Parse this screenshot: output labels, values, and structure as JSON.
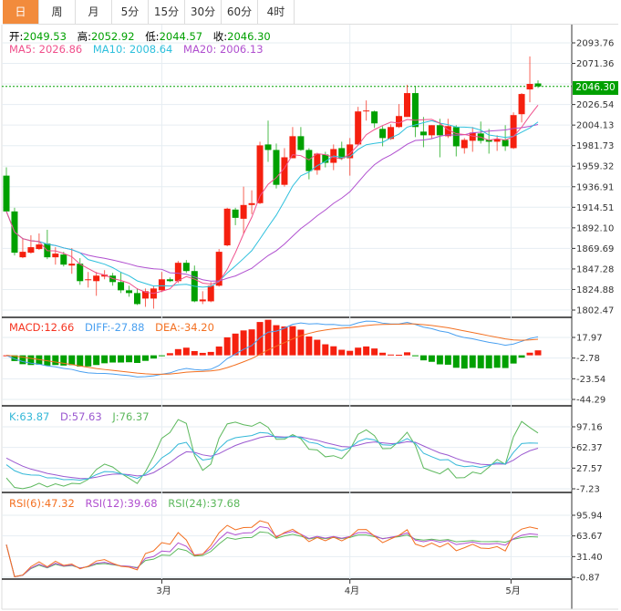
{
  "tabs": [
    "日",
    "周",
    "月",
    "5分",
    "15分",
    "30分",
    "60分",
    "4时"
  ],
  "active_tab": 0,
  "ohlc": {
    "open_label": "开:",
    "open": "2049.53",
    "high_label": "高:",
    "high": "2052.92",
    "low_label": "低:",
    "low": "2044.57",
    "close_label": "收:",
    "close": "2046.30"
  },
  "ma": {
    "ma5_label": "MA5:",
    "ma5": "2026.86",
    "ma10_label": "MA10:",
    "ma10": "2008.64",
    "ma20_label": "MA20:",
    "ma20": "2006.13"
  },
  "macd": {
    "macd_label": "MACD:",
    "macd": "12.66",
    "diff_label": "DIFF:",
    "diff": "-27.88",
    "dea_label": "DEA:",
    "dea": "-34.20"
  },
  "kdj": {
    "k_label": "K:",
    "k": "63.87",
    "d_label": "D:",
    "d": "57.63",
    "j_label": "J:",
    "j": "76.37"
  },
  "rsi": {
    "r6_label": "RSI(6):",
    "r6": "47.32",
    "r12_label": "RSI(12):",
    "r12": "39.68",
    "r24_label": "RSI(24):",
    "r24": "37.68"
  },
  "current_price": "2046.30",
  "colors": {
    "up": "#f5200f",
    "down": "#00a000",
    "ma5": "#f0508c",
    "ma10": "#2ec0dd",
    "ma20": "#b04fcf",
    "diff": "#4aa0f0",
    "dea": "#f37021",
    "accent": "#f28b3c"
  },
  "chart_data": {
    "type": "candlestick",
    "price_ticks": [
      "2093.76",
      "2071.36",
      "2048.95",
      "2026.54",
      "2004.13",
      "1981.73",
      "1959.32",
      "1936.91",
      "1914.51",
      "1892.10",
      "1869.69",
      "1847.28",
      "1824.88",
      "1802.47"
    ],
    "price_range": [
      1802.47,
      2093.76
    ],
    "macd_ticks": [
      "17.97",
      "-2.78",
      "-23.54",
      "-44.29"
    ],
    "kdj_ticks": [
      "97.16",
      "62.37",
      "27.57",
      "-7.23"
    ],
    "rsi_ticks": [
      "95.94",
      "63.67",
      "31.40",
      "-0.87"
    ],
    "x_labels": [
      {
        "label": "3月",
        "index": 19
      },
      {
        "label": "4月",
        "index": 42
      },
      {
        "label": "5月",
        "index": 61.7
      }
    ],
    "candles": [
      [
        1949,
        1958,
        1910,
        1910
      ],
      [
        1910,
        1914,
        1862,
        1865
      ],
      [
        1860,
        1881,
        1859,
        1866
      ],
      [
        1865,
        1884,
        1864,
        1871
      ],
      [
        1869,
        1886,
        1868,
        1874
      ],
      [
        1875,
        1890,
        1858,
        1860
      ],
      [
        1860,
        1871,
        1852,
        1864
      ],
      [
        1863,
        1866,
        1850,
        1852
      ],
      [
        1851,
        1870,
        1842,
        1853
      ],
      [
        1853,
        1859,
        1830,
        1834
      ],
      [
        1835,
        1844,
        1827,
        1836
      ],
      [
        1834,
        1844,
        1818,
        1840
      ],
      [
        1839,
        1846,
        1836,
        1841
      ],
      [
        1840,
        1843,
        1829,
        1833
      ],
      [
        1833,
        1844,
        1821,
        1824
      ],
      [
        1824,
        1829,
        1817,
        1821
      ],
      [
        1821,
        1826,
        1808,
        1809
      ],
      [
        1815,
        1826,
        1806,
        1823
      ],
      [
        1815,
        1829,
        1804,
        1826
      ],
      [
        1824,
        1844,
        1822,
        1836
      ],
      [
        1836,
        1838,
        1833,
        1834
      ],
      [
        1834,
        1856,
        1832,
        1854
      ],
      [
        1854,
        1857,
        1843,
        1845
      ],
      [
        1845,
        1851,
        1811,
        1812
      ],
      [
        1812,
        1823,
        1809,
        1814
      ],
      [
        1812,
        1833,
        1811,
        1829
      ],
      [
        1829,
        1869,
        1828,
        1866
      ],
      [
        1873,
        1914,
        1872,
        1913
      ],
      [
        1912,
        1914,
        1895,
        1903
      ],
      [
        1902,
        1937,
        1886,
        1917
      ],
      [
        1917,
        1933,
        1907,
        1919
      ],
      [
        1919,
        1986,
        1918,
        1982
      ],
      [
        1983,
        2009,
        1964,
        1977
      ],
      [
        1977,
        1984,
        1935,
        1939
      ],
      [
        1939,
        1979,
        1937,
        1969
      ],
      [
        1968,
        2002,
        1968,
        1992
      ],
      [
        1992,
        2002,
        1976,
        1977
      ],
      [
        1977,
        1979,
        1945,
        1954
      ],
      [
        1955,
        1974,
        1950,
        1973
      ],
      [
        1972,
        1975,
        1958,
        1963
      ],
      [
        1963,
        1983,
        1955,
        1978
      ],
      [
        1979,
        1986,
        1966,
        1968
      ],
      [
        1968,
        1990,
        1949,
        1983
      ],
      [
        1983,
        2024,
        1982,
        2019
      ],
      [
        2019,
        2031,
        2009,
        2020
      ],
      [
        2019,
        2020,
        2001,
        2006
      ],
      [
        2000,
        2003,
        1981,
        1990
      ],
      [
        1989,
        2005,
        1988,
        2002
      ],
      [
        2002,
        2027,
        2001,
        2014
      ],
      [
        2013,
        2048,
        2013,
        2039
      ],
      [
        2039,
        2047,
        1991,
        2002
      ],
      [
        1997,
        2013,
        1980,
        1993
      ],
      [
        1993,
        2004,
        1989,
        2004
      ],
      [
        2004,
        2011,
        1969,
        1993
      ],
      [
        1992,
        2011,
        1990,
        2003
      ],
      [
        2002,
        2004,
        1970,
        1981
      ],
      [
        1979,
        1990,
        1973,
        1988
      ],
      [
        1987,
        2002,
        1975,
        1996
      ],
      [
        1995,
        2008,
        1984,
        1987
      ],
      [
        1988,
        2000,
        1973,
        1986
      ],
      [
        1986,
        1993,
        1976,
        1989
      ],
      [
        1988,
        2004,
        1976,
        1981
      ],
      [
        1979,
        2018,
        1978,
        2015
      ],
      [
        2016,
        2039,
        2007,
        2038
      ],
      [
        2043,
        2079,
        2029,
        2049
      ],
      [
        2049.53,
        2052.92,
        2044.57,
        2046.3
      ]
    ]
  }
}
